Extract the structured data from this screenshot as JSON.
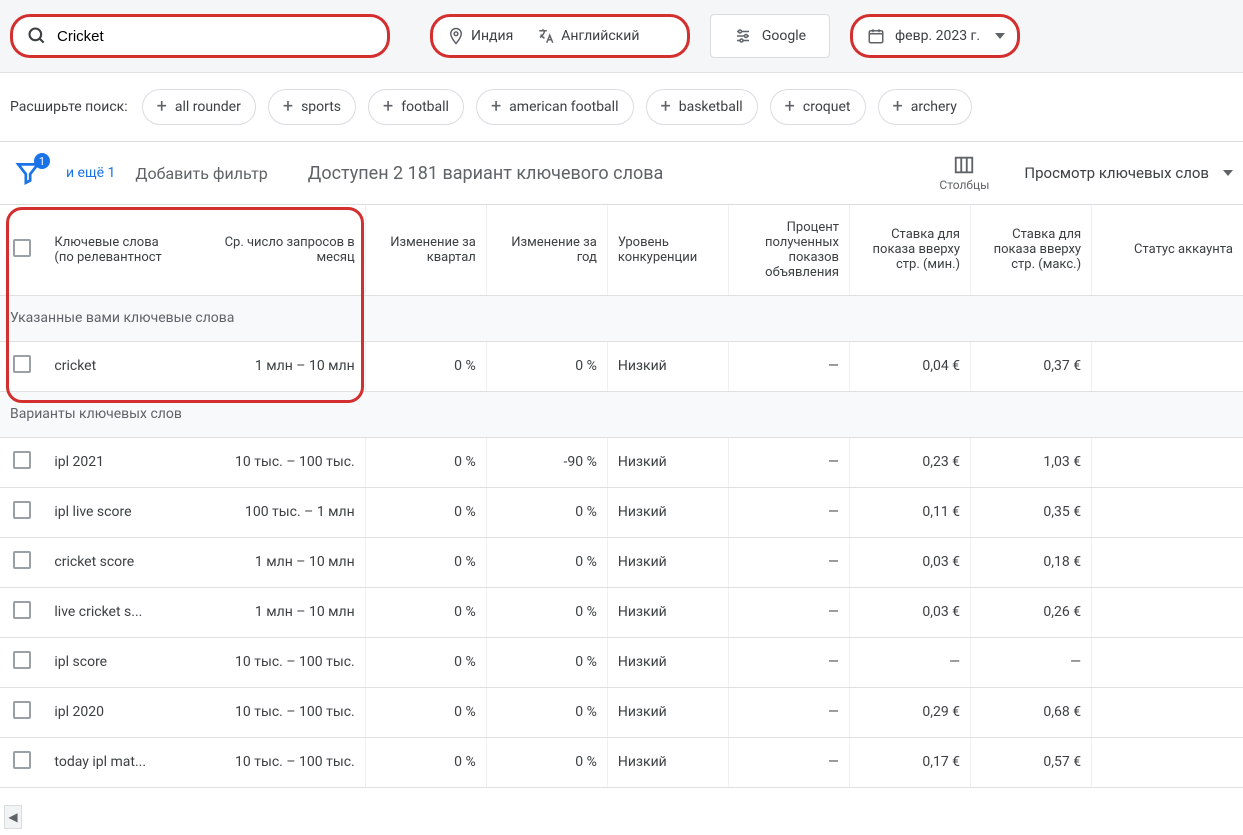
{
  "topbar": {
    "search_value": "Cricket",
    "location": "Индия",
    "language": "Английский",
    "search_engine": "Google",
    "date_range": "февр. 2023 г."
  },
  "expand": {
    "label": "Расширьте поиск:",
    "chips": [
      "all rounder",
      "sports",
      "football",
      "american football",
      "basketball",
      "croquet",
      "archery"
    ]
  },
  "filters": {
    "funnel_count": "1",
    "more_label": "и ещё 1",
    "add_filter": "Добавить фильтр",
    "title": "Доступен 2 181 вариант ключевого слова",
    "columns_label": "Столбцы",
    "view_label": "Просмотр ключевых слов"
  },
  "table": {
    "headers": {
      "kw": "Ключевые слова (по релевантност",
      "vol": "Ср. число запросов в месяц",
      "q": "Изменение за квартал",
      "y": "Изменение за год",
      "comp": "Уровень конкуренции",
      "imp": "Процент полученных показов объявления",
      "bidlo": "Ставка для показа вверху стр. (мин.)",
      "bidhi": "Ставка для показа вверху стр. (макс.)",
      "stat": "Статус аккаунта"
    },
    "section1": "Указанные вами ключевые слова",
    "section2": "Варианты ключевых слов",
    "rows1": [
      {
        "kw": "cricket",
        "vol": "1 млн – 10 млн",
        "q": "0 %",
        "y": "0 %",
        "comp": "Низкий",
        "imp": "—",
        "bidlo": "0,04 €",
        "bidhi": "0,37 €",
        "stat": ""
      }
    ],
    "rows2": [
      {
        "kw": "ipl 2021",
        "vol": "10 тыс. – 100 тыс.",
        "q": "0 %",
        "y": "-90 %",
        "comp": "Низкий",
        "imp": "—",
        "bidlo": "0,23 €",
        "bidhi": "1,03 €",
        "stat": ""
      },
      {
        "kw": "ipl live score",
        "vol": "100 тыс. – 1 млн",
        "q": "0 %",
        "y": "0 %",
        "comp": "Низкий",
        "imp": "—",
        "bidlo": "0,11 €",
        "bidhi": "0,35 €",
        "stat": ""
      },
      {
        "kw": "cricket score",
        "vol": "1 млн – 10 млн",
        "q": "0 %",
        "y": "0 %",
        "comp": "Низкий",
        "imp": "—",
        "bidlo": "0,03 €",
        "bidhi": "0,18 €",
        "stat": ""
      },
      {
        "kw": "live cricket s...",
        "vol": "1 млн – 10 млн",
        "q": "0 %",
        "y": "0 %",
        "comp": "Низкий",
        "imp": "—",
        "bidlo": "0,03 €",
        "bidhi": "0,26 €",
        "stat": ""
      },
      {
        "kw": "ipl score",
        "vol": "10 тыс. – 100 тыс.",
        "q": "0 %",
        "y": "0 %",
        "comp": "Низкий",
        "imp": "—",
        "bidlo": "—",
        "bidhi": "—",
        "stat": ""
      },
      {
        "kw": "ipl 2020",
        "vol": "10 тыс. – 100 тыс.",
        "q": "0 %",
        "y": "0 %",
        "comp": "Низкий",
        "imp": "—",
        "bidlo": "0,29 €",
        "bidhi": "0,68 €",
        "stat": ""
      },
      {
        "kw": "today ipl mat...",
        "vol": "10 тыс. – 100 тыс.",
        "q": "0 %",
        "y": "0 %",
        "comp": "Низкий",
        "imp": "—",
        "bidlo": "0,17 €",
        "bidhi": "0,57 €",
        "stat": ""
      }
    ]
  }
}
